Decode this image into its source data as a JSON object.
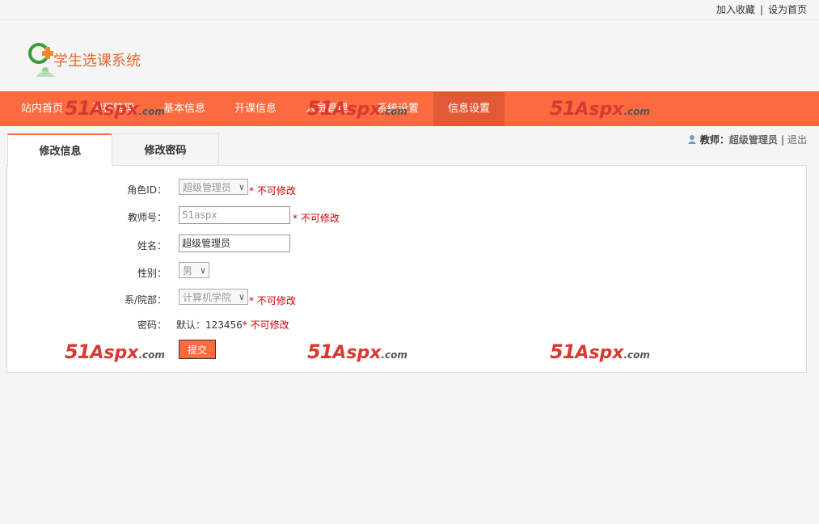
{
  "top_links": {
    "favorite": "加入收藏",
    "separator": "|",
    "homepage": "设为首页"
  },
  "logo": {
    "text": "学生选课系统"
  },
  "nav": {
    "items": [
      {
        "label": "站内首页"
      },
      {
        "label": "课程管理"
      },
      {
        "label": "基本信息"
      },
      {
        "label": "开课信息"
      },
      {
        "label": "人员管理"
      },
      {
        "label": "系统设置"
      },
      {
        "label": "信息设置"
      }
    ],
    "active_index": 6
  },
  "watermark": {
    "num": "51",
    "brand": "Aspx",
    "domain": ".com"
  },
  "tabs": [
    {
      "label": "修改信息"
    },
    {
      "label": "修改密码"
    }
  ],
  "user": {
    "role": "教师：",
    "name": "超级管理员",
    "separator": "|",
    "logout": "退出"
  },
  "form": {
    "role_id": {
      "label": "角色ID：",
      "value": "超级管理员",
      "note": "* 不可修改"
    },
    "teacher_no": {
      "label": "教师号：",
      "value": "51aspx",
      "note": "* 不可修改"
    },
    "name": {
      "label": "姓名：",
      "value": "超级管理员"
    },
    "gender": {
      "label": "性别：",
      "value": "男"
    },
    "department": {
      "label": "系/院部：",
      "value": "计算机学院",
      "note": "* 不可修改"
    },
    "password": {
      "label": "密码：",
      "value": "默认：123456",
      "note": "* 不可修改"
    },
    "submit_label": "提交"
  },
  "colors": {
    "accent": "#fb6b3f",
    "accent_active": "#e25a35",
    "error": "#cc0000"
  }
}
